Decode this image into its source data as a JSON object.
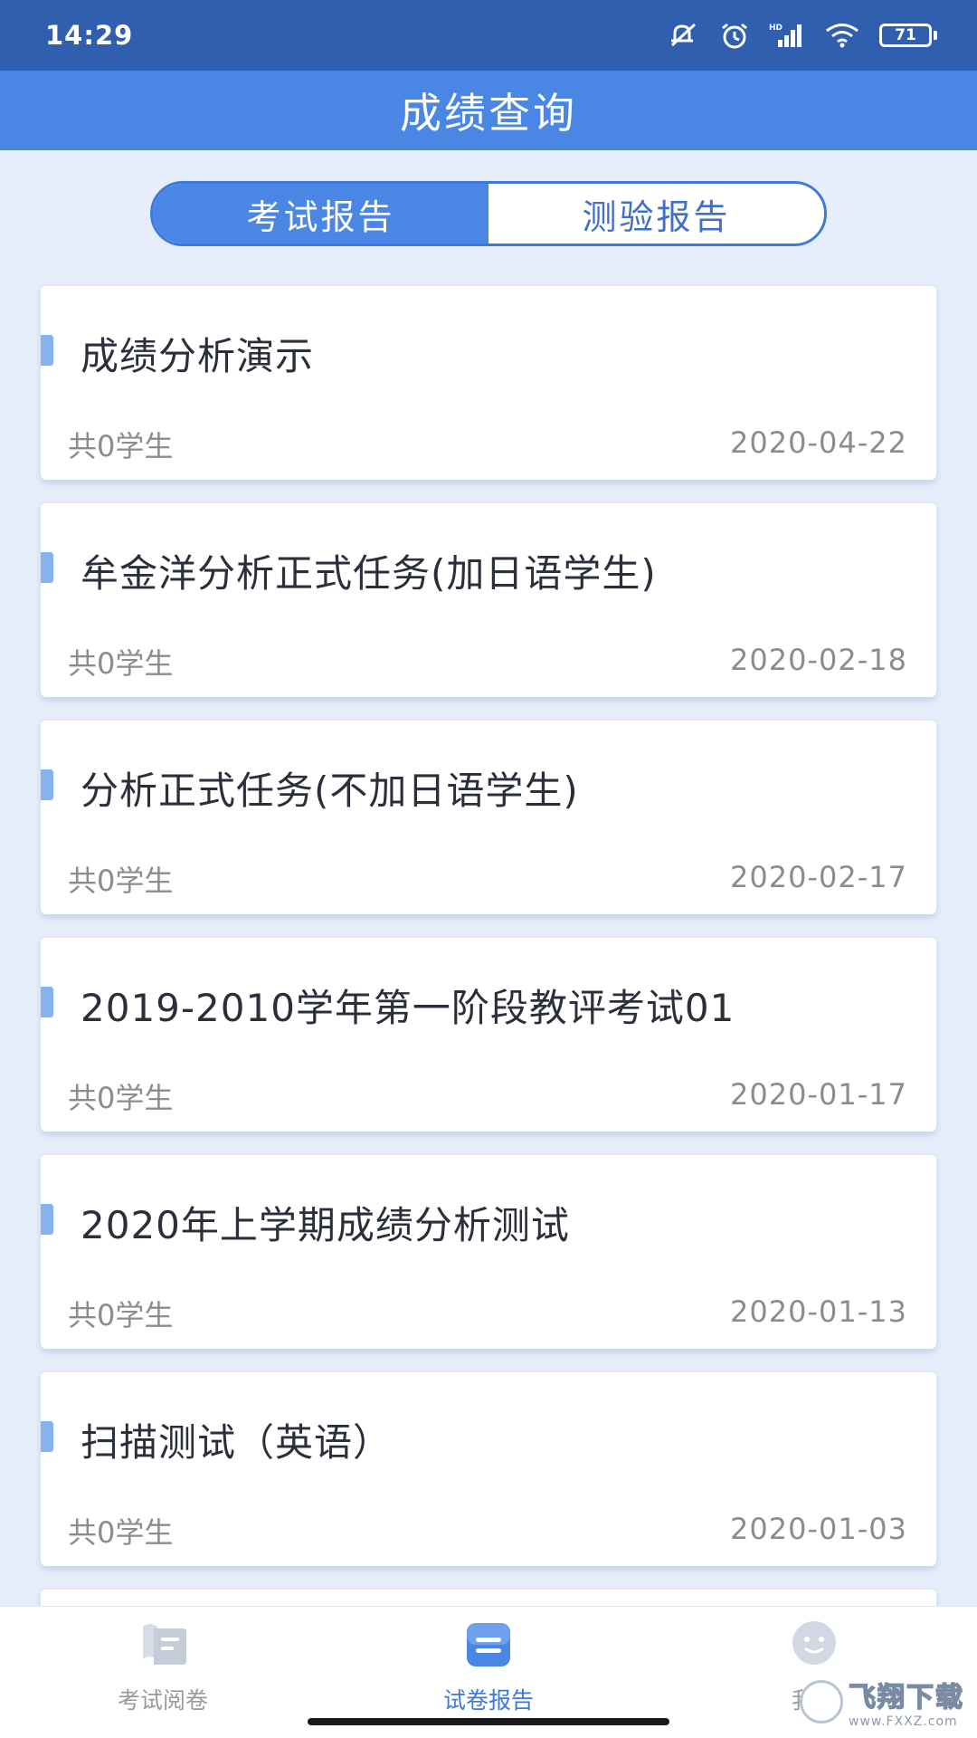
{
  "status_bar": {
    "time": "14:29",
    "icons": [
      "mute-icon",
      "alarm-icon",
      "hd-signal-icon",
      "wifi-icon",
      "battery-icon"
    ],
    "battery_level": "71"
  },
  "header": {
    "title": "成绩查询"
  },
  "tabs": [
    {
      "label": "考试报告",
      "active": true
    },
    {
      "label": "测验报告",
      "active": false
    }
  ],
  "reports": [
    {
      "title": "成绩分析演示",
      "count": "共0学生",
      "date": "2020-04-22"
    },
    {
      "title": "牟金洋分析正式任务(加日语学生)",
      "count": "共0学生",
      "date": "2020-02-18"
    },
    {
      "title": "分析正式任务(不加日语学生)",
      "count": "共0学生",
      "date": "2020-02-17"
    },
    {
      "title": "2019-2010学年第一阶段教评考试01",
      "count": "共0学生",
      "date": "2020-01-17"
    },
    {
      "title": "2020年上学期成绩分析测试",
      "count": "共0学生",
      "date": "2020-01-13"
    },
    {
      "title": "扫描测试（英语）",
      "count": "共0学生",
      "date": "2020-01-03"
    }
  ],
  "bottom_nav": [
    {
      "label": "考试阅卷",
      "icon": "exam-review-icon",
      "active": false
    },
    {
      "label": "试卷报告",
      "icon": "paper-report-icon",
      "active": true
    },
    {
      "label": "我的",
      "icon": "profile-icon",
      "active": false
    }
  ],
  "watermark": {
    "cn": "飞翔下载",
    "en": "www.FXXZ.com"
  },
  "colors": {
    "status_bar": "#2f5fae",
    "primary": "#4a86e3",
    "background": "#e6eefb",
    "marker": "#86b2f0"
  }
}
